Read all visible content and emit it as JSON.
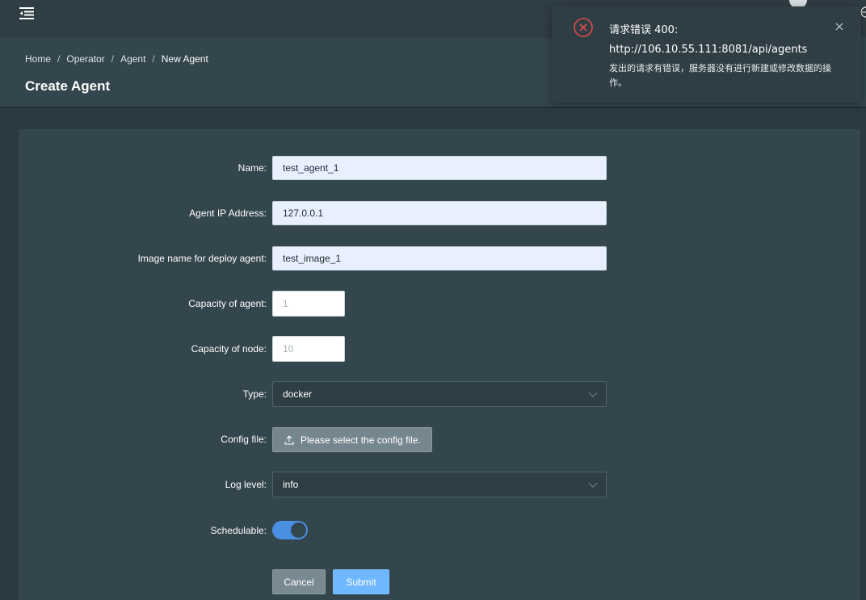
{
  "breadcrumb": [
    "Home",
    "Operator",
    "Agent",
    "New Agent"
  ],
  "breadcrumb_sep": "/",
  "page_title": "Create Agent",
  "form": {
    "name": {
      "label": "Name:",
      "value": "test_agent_1"
    },
    "ip": {
      "label": "Agent IP Address:",
      "value": "127.0.0.1"
    },
    "image": {
      "label": "Image name for deploy agent:",
      "value": "test_image_1"
    },
    "capacity_agent": {
      "label": "Capacity of agent:",
      "placeholder": "1"
    },
    "capacity_node": {
      "label": "Capacity of node:",
      "placeholder": "10"
    },
    "type": {
      "label": "Type:",
      "value": "docker"
    },
    "config_file": {
      "label": "Config file:",
      "button": "Please select the config file."
    },
    "log_level": {
      "label": "Log level:",
      "value": "info"
    },
    "schedulable": {
      "label": "Schedulable:",
      "value": true
    }
  },
  "buttons": {
    "cancel": "Cancel",
    "submit": "Submit"
  },
  "notification": {
    "title_line1": "请求错误 400:",
    "title_line2": "http://106.10.55.111:8081/api/agents",
    "description": "发出的请求有错误，服务器没有进行新建或修改数据的操作。",
    "icon": "close-circle-icon"
  },
  "colors": {
    "background": "#2b3a42",
    "panel": "#33454d",
    "input_fill": "#e8f0fe",
    "primary": "#6fb8ff",
    "toggle_on": "#4a90e2",
    "error": "#e04a4a"
  }
}
